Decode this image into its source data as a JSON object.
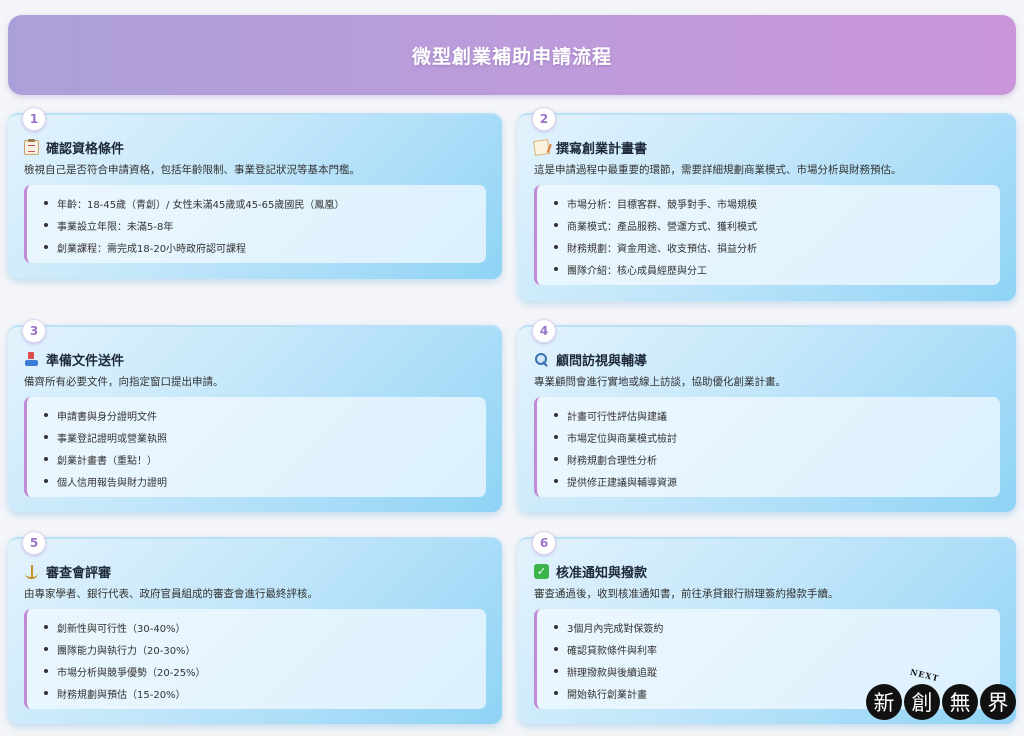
{
  "header": {
    "title": "微型創業補助申請流程"
  },
  "steps": [
    {
      "num": "1",
      "icon": "clipboard-icon",
      "title": "確認資格條件",
      "desc": "檢視自己是否符合申請資格，包括年齡限制、事業登記狀況等基本門檻。",
      "items": [
        "年齡：18-45歲（青創）/ 女性未滿45歲或45-65歲國民（鳳凰）",
        "事業設立年限：未滿5-8年",
        "創業課程：需完成18-20小時政府認可課程"
      ]
    },
    {
      "num": "2",
      "icon": "memo-icon",
      "title": "撰寫創業計畫書",
      "desc": "這是申請過程中最重要的環節，需要詳細規劃商業模式、市場分析與財務預估。",
      "items": [
        "市場分析：目標客群、競爭對手、市場規模",
        "商業模式：產品服務、營運方式、獲利模式",
        "財務規劃：資金用途、收支預估、損益分析",
        "團隊介紹：核心成員經歷與分工"
      ]
    },
    {
      "num": "3",
      "icon": "inbox-tray-icon",
      "title": "準備文件送件",
      "desc": "備齊所有必要文件，向指定窗口提出申請。",
      "items": [
        "申請書與身分證明文件",
        "事業登記證明或營業執照",
        "創業計畫書（重點！）",
        "個人信用報告與財力證明"
      ]
    },
    {
      "num": "4",
      "icon": "magnifier-icon",
      "title": "顧問訪視與輔導",
      "desc": "專業顧問會進行實地或線上訪談，協助優化創業計畫。",
      "items": [
        "計畫可行性評估與建議",
        "市場定位與商業模式檢討",
        "財務規劃合理性分析",
        "提供修正建議與輔導資源"
      ]
    },
    {
      "num": "5",
      "icon": "scale-icon",
      "title": "審查會評審",
      "desc": "由專家學者、銀行代表、政府官員組成的審查會進行最終評核。",
      "items": [
        "創新性與可行性（30-40%）",
        "團隊能力與執行力（20-30%）",
        "市場分析與競爭優勢（20-25%）",
        "財務規劃與預估（15-20%）"
      ]
    },
    {
      "num": "6",
      "icon": "check-mark-icon",
      "title": "核准通知與撥款",
      "desc": "審查通過後，收到核准通知書，前往承貸銀行辦理簽約撥款手續。",
      "items": [
        "3個月內完成對保簽約",
        "確認貸款條件與利率",
        "辦理撥款與後續追蹤",
        "開始執行創業計畫"
      ]
    }
  ],
  "logo": {
    "small": "NEXT",
    "chars": [
      "新",
      "創",
      "無",
      "界"
    ]
  },
  "colors": {
    "header_start": "#ab9fda",
    "header_end": "#cb95da",
    "card_light": "#e3f3fc",
    "card_dark": "#8fd3f5",
    "accent_border": "#c18ad6",
    "badge_text": "#9a74c9"
  }
}
